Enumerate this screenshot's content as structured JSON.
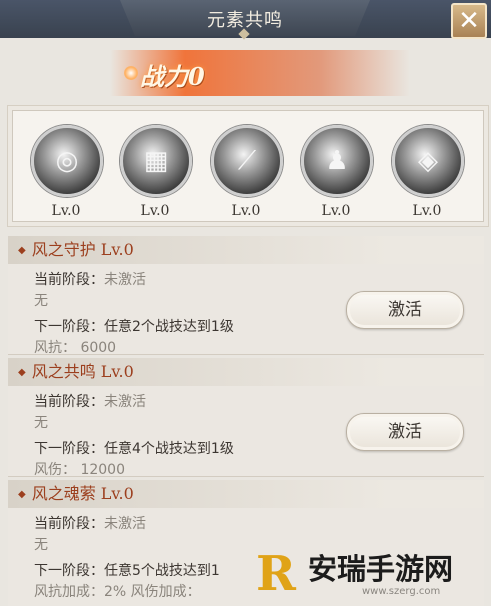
{
  "header": {
    "title": "元素共鸣",
    "close_label": "✕"
  },
  "power": {
    "label": "战力0"
  },
  "elements": [
    {
      "icon": "wind-swirl-icon",
      "glyph": "◎",
      "level": "Lv.0"
    },
    {
      "icon": "cube-icon",
      "glyph": "▦",
      "level": "Lv.0"
    },
    {
      "icon": "slash-icon",
      "glyph": "⟋",
      "level": "Lv.0"
    },
    {
      "icon": "figure-icon",
      "glyph": "♟",
      "level": "Lv.0"
    },
    {
      "icon": "flame-eye-icon",
      "glyph": "◈",
      "level": "Lv.0"
    }
  ],
  "sections": [
    {
      "title": "风之守护  Lv.0",
      "current_label": "当前阶段：",
      "current_value": "未激活",
      "current_effect": "无",
      "next_label": "下一阶段：",
      "next_value": "任意2个战技达到1级",
      "bonus": "风抗：  6000",
      "button": "激活"
    },
    {
      "title": "风之共鸣  Lv.0",
      "current_label": "当前阶段：",
      "current_value": "未激活",
      "current_effect": "无",
      "next_label": "下一阶段：",
      "next_value": "任意4个战技达到1级",
      "bonus": "风伤：  12000",
      "button": "激活"
    },
    {
      "title": "风之魂萦  Lv.0",
      "current_label": "当前阶段：",
      "current_value": "未激活",
      "current_effect": "无",
      "next_label": "下一阶段：",
      "next_value": "任意5个战技达到1",
      "bonus": "风抗加成：2%      风伤加成：",
      "button": ""
    }
  ],
  "watermark": {
    "logo": "R",
    "text": "安瑞手游网",
    "url": "www.szerg.com"
  },
  "colors": {
    "accent": "#9c3f1e",
    "header": "#39424f",
    "close": "#c19b68",
    "watermark": "#e0a317"
  }
}
